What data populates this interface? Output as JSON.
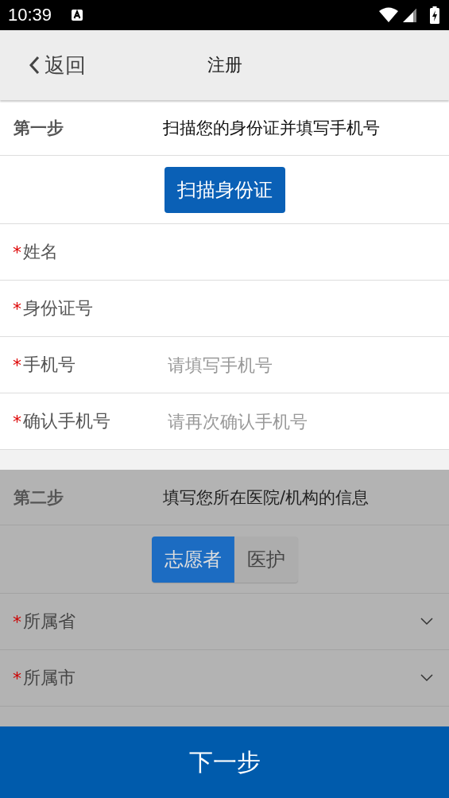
{
  "status_bar": {
    "time": "10:39"
  },
  "header": {
    "back": "返回",
    "title": "注册"
  },
  "sections": [
    {
      "step": "第一步",
      "description": "扫描您的身份证并填写手机号",
      "disabled": false,
      "action": {
        "label": "扫描身份证"
      },
      "fields": [
        {
          "label": "姓名",
          "required_mark": "*",
          "kind": "text"
        },
        {
          "label": "身份证号",
          "required_mark": "*",
          "kind": "text"
        },
        {
          "label": "手机号",
          "required_mark": "*",
          "kind": "text",
          "placeholder": "请填写手机号"
        },
        {
          "label": "确认手机号",
          "required_mark": "*",
          "kind": "text",
          "placeholder": "请再次确认手机号"
        }
      ]
    },
    {
      "step": "第二步",
      "description": "填写您所在医院/机构的信息",
      "disabled": true,
      "segments": [
        {
          "label": "志愿者",
          "selected": true
        },
        {
          "label": "医护",
          "selected": false
        }
      ],
      "fields": [
        {
          "label": "所属省",
          "required_mark": "*",
          "kind": "select"
        },
        {
          "label": "所属市",
          "required_mark": "*",
          "kind": "select"
        }
      ]
    }
  ],
  "next_button": {
    "label": "下一步"
  }
}
